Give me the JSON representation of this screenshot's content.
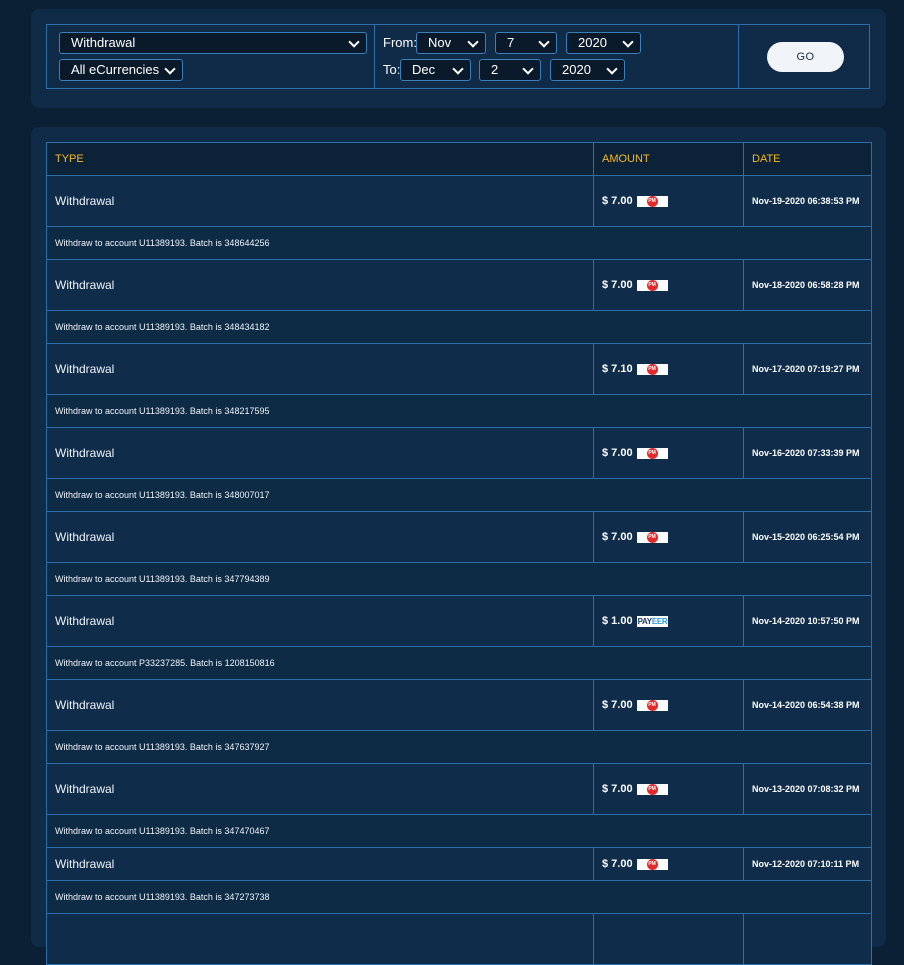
{
  "filters": {
    "type_value": "Withdrawal",
    "currency_value": "All eCurrencies",
    "from_label": "From:",
    "to_label": "To:",
    "from_month": "Nov",
    "from_day": "7",
    "from_year": "2020",
    "to_month": "Dec",
    "to_day": "2",
    "to_year": "2020",
    "go_label": "GO"
  },
  "table": {
    "headers": {
      "type": "TYPE",
      "amount": "AMOUNT",
      "date": "DATE"
    },
    "rows": [
      {
        "type": "Withdrawal",
        "amount": "$ 7.00",
        "currency": "PM",
        "date": "Nov-19-2020 06:38:53 PM",
        "description": "Withdraw to account U11389193. Batch is 348644256"
      },
      {
        "type": "Withdrawal",
        "amount": "$ 7.00",
        "currency": "PM",
        "date": "Nov-18-2020 06:58:28 PM",
        "description": "Withdraw to account U11389193. Batch is 348434182"
      },
      {
        "type": "Withdrawal",
        "amount": "$ 7.10",
        "currency": "PM",
        "date": "Nov-17-2020 07:19:27 PM",
        "description": "Withdraw to account U11389193. Batch is 348217595"
      },
      {
        "type": "Withdrawal",
        "amount": "$ 7.00",
        "currency": "PM",
        "date": "Nov-16-2020 07:33:39 PM",
        "description": "Withdraw to account U11389193. Batch is 348007017"
      },
      {
        "type": "Withdrawal",
        "amount": "$ 7.00",
        "currency": "PM",
        "date": "Nov-15-2020 06:25:54 PM",
        "description": "Withdraw to account U11389193. Batch is 347794389"
      },
      {
        "type": "Withdrawal",
        "amount": "$ 1.00",
        "currency": "PAYEER",
        "date": "Nov-14-2020 10:57:50 PM",
        "description": "Withdraw to account P33237285. Batch is 1208150816"
      },
      {
        "type": "Withdrawal",
        "amount": "$ 7.00",
        "currency": "PM",
        "date": "Nov-14-2020 06:54:38 PM",
        "description": "Withdraw to account U11389193. Batch is 347637927"
      },
      {
        "type": "Withdrawal",
        "amount": "$ 7.00",
        "currency": "PM",
        "date": "Nov-13-2020 07:08:32 PM",
        "description": "Withdraw to account U11389193. Batch is 347470467"
      },
      {
        "type": "Withdrawal",
        "amount": "$ 7.00",
        "currency": "PM",
        "date": "Nov-12-2020 07:10:11 PM",
        "description": "Withdraw to account U11389193. Batch is 347273738"
      }
    ]
  },
  "colors": {
    "page_bg": "#0b2035",
    "panel_bg": "#0f2b48",
    "border": "#2d6fa8",
    "header_text": "#f5b922",
    "pm_red": "#e22a2a"
  }
}
